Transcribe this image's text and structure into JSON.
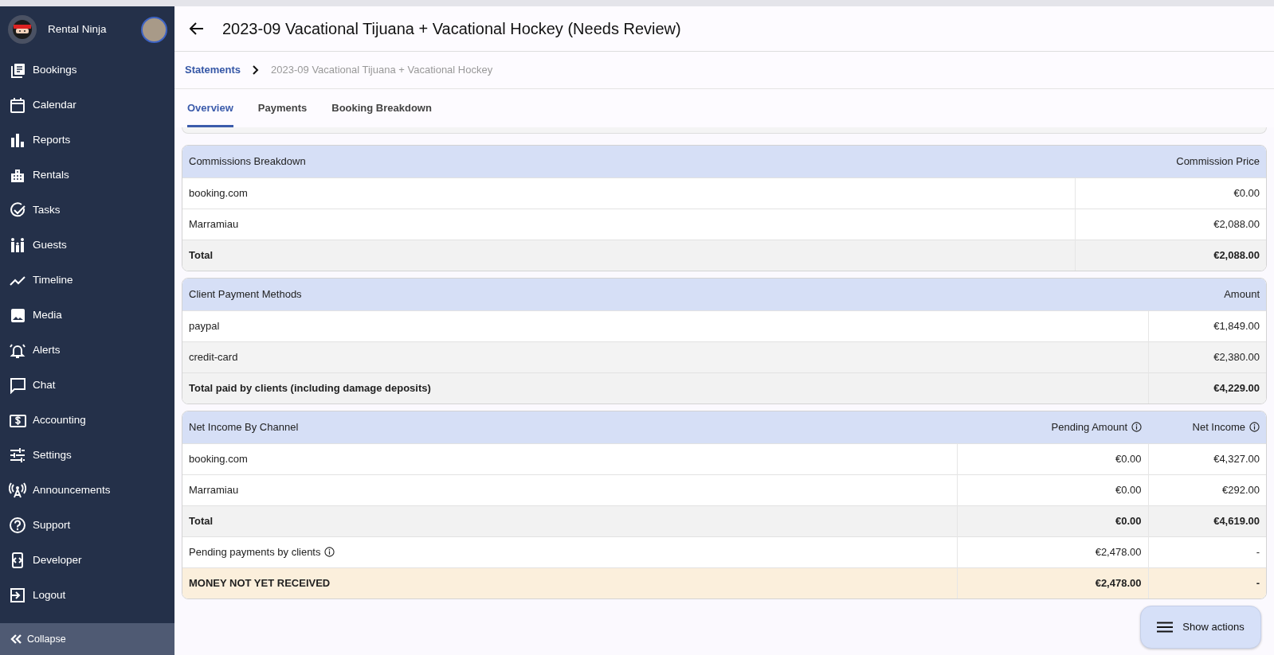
{
  "sidebar": {
    "brand": "Rental Ninja",
    "items": [
      {
        "label": "Bookings"
      },
      {
        "label": "Calendar"
      },
      {
        "label": "Reports"
      },
      {
        "label": "Rentals"
      },
      {
        "label": "Tasks"
      },
      {
        "label": "Guests"
      },
      {
        "label": "Timeline"
      },
      {
        "label": "Media"
      },
      {
        "label": "Alerts"
      },
      {
        "label": "Chat"
      },
      {
        "label": "Accounting"
      },
      {
        "label": "Settings"
      },
      {
        "label": "Announcements"
      },
      {
        "label": "Support"
      },
      {
        "label": "Developer"
      },
      {
        "label": "Logout"
      }
    ],
    "collapse": "Collapse"
  },
  "header": {
    "title": "2023-09 Vacational Tijuana + Vacational Hockey (Needs Review)"
  },
  "breadcrumb": [
    {
      "label": "Statements",
      "link": true
    },
    {
      "label": "2023-09 Vacational Tijuana + Vacational Hockey",
      "link": false
    }
  ],
  "tabs": [
    {
      "label": "Overview",
      "selected": true
    },
    {
      "label": "Payments",
      "selected": false
    },
    {
      "label": "Booking Breakdown",
      "selected": false
    }
  ],
  "tables": [
    {
      "columns": [
        {
          "label": "Commissions Breakdown",
          "info": false
        },
        {
          "label": "Commission Price",
          "info": false
        }
      ],
      "rows": [
        {
          "kind": "plain",
          "cells": [
            {
              "text": "booking.com",
              "info": false
            },
            {
              "text": "€0.00",
              "info": false
            }
          ]
        },
        {
          "kind": "plain",
          "cells": [
            {
              "text": "Marramiau",
              "info": false
            },
            {
              "text": "€2,088.00",
              "info": false
            }
          ]
        },
        {
          "kind": "total",
          "cells": [
            {
              "text": "Total",
              "info": false
            },
            {
              "text": "€2,088.00",
              "info": false
            }
          ]
        }
      ]
    },
    {
      "columns": [
        {
          "label": "Client Payment Methods",
          "info": false
        },
        {
          "label": "Amount",
          "info": false
        }
      ],
      "rows": [
        {
          "kind": "plain",
          "cells": [
            {
              "text": "paypal",
              "info": false
            },
            {
              "text": "€1,849.00",
              "info": false
            }
          ]
        },
        {
          "kind": "shaded",
          "cells": [
            {
              "text": "credit-card",
              "info": false
            },
            {
              "text": "€2,380.00",
              "info": false
            }
          ]
        },
        {
          "kind": "total",
          "cells": [
            {
              "text": "Total paid by clients (including damage deposits)",
              "info": false
            },
            {
              "text": "€4,229.00",
              "info": false
            }
          ]
        }
      ]
    },
    {
      "columns": [
        {
          "label": "Net Income By Channel",
          "info": false
        },
        {
          "label": "Pending Amount",
          "info": true
        },
        {
          "label": "Net Income",
          "info": true
        }
      ],
      "rows": [
        {
          "kind": "plain",
          "cells": [
            {
              "text": "booking.com",
              "info": false
            },
            {
              "text": "€0.00",
              "info": false
            },
            {
              "text": "€4,327.00",
              "info": false
            }
          ]
        },
        {
          "kind": "plain",
          "cells": [
            {
              "text": "Marramiau",
              "info": false
            },
            {
              "text": "€0.00",
              "info": false
            },
            {
              "text": "€292.00",
              "info": false
            }
          ]
        },
        {
          "kind": "total",
          "cells": [
            {
              "text": "Total",
              "info": false
            },
            {
              "text": "€0.00",
              "info": false
            },
            {
              "text": "€4,619.00",
              "info": false
            }
          ]
        },
        {
          "kind": "plain",
          "cells": [
            {
              "text": "Pending payments by clients",
              "info": true
            },
            {
              "text": "€2,478.00",
              "info": false
            },
            {
              "text": "-",
              "info": false
            }
          ]
        },
        {
          "kind": "alert",
          "cells": [
            {
              "text": "MONEY NOT YET RECEIVED",
              "info": false
            },
            {
              "text": "€2,478.00",
              "info": false
            },
            {
              "text": "-",
              "info": false
            }
          ]
        }
      ]
    }
  ],
  "actions_button": "Show actions"
}
